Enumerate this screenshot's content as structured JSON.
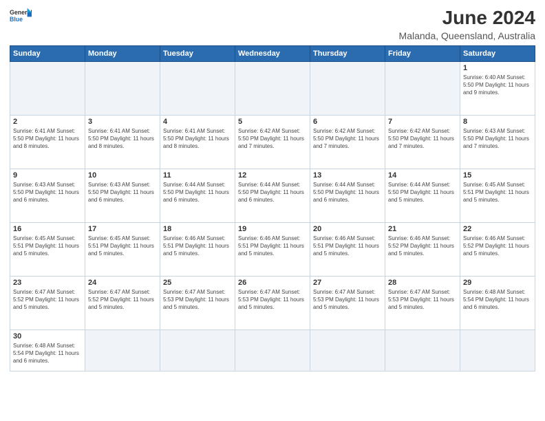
{
  "header": {
    "logo_general": "General",
    "logo_blue": "Blue",
    "month": "June 2024",
    "location": "Malanda, Queensland, Australia"
  },
  "days_of_week": [
    "Sunday",
    "Monday",
    "Tuesday",
    "Wednesday",
    "Thursday",
    "Friday",
    "Saturday"
  ],
  "weeks": [
    [
      {
        "day": "",
        "info": ""
      },
      {
        "day": "",
        "info": ""
      },
      {
        "day": "",
        "info": ""
      },
      {
        "day": "",
        "info": ""
      },
      {
        "day": "",
        "info": ""
      },
      {
        "day": "",
        "info": ""
      },
      {
        "day": "1",
        "info": "Sunrise: 6:40 AM\nSunset: 5:50 PM\nDaylight: 11 hours\nand 9 minutes."
      }
    ],
    [
      {
        "day": "2",
        "info": "Sunrise: 6:41 AM\nSunset: 5:50 PM\nDaylight: 11 hours\nand 8 minutes."
      },
      {
        "day": "3",
        "info": "Sunrise: 6:41 AM\nSunset: 5:50 PM\nDaylight: 11 hours\nand 8 minutes."
      },
      {
        "day": "4",
        "info": "Sunrise: 6:41 AM\nSunset: 5:50 PM\nDaylight: 11 hours\nand 8 minutes."
      },
      {
        "day": "5",
        "info": "Sunrise: 6:42 AM\nSunset: 5:50 PM\nDaylight: 11 hours\nand 7 minutes."
      },
      {
        "day": "6",
        "info": "Sunrise: 6:42 AM\nSunset: 5:50 PM\nDaylight: 11 hours\nand 7 minutes."
      },
      {
        "day": "7",
        "info": "Sunrise: 6:42 AM\nSunset: 5:50 PM\nDaylight: 11 hours\nand 7 minutes."
      },
      {
        "day": "8",
        "info": "Sunrise: 6:43 AM\nSunset: 5:50 PM\nDaylight: 11 hours\nand 7 minutes."
      }
    ],
    [
      {
        "day": "9",
        "info": "Sunrise: 6:43 AM\nSunset: 5:50 PM\nDaylight: 11 hours\nand 6 minutes."
      },
      {
        "day": "10",
        "info": "Sunrise: 6:43 AM\nSunset: 5:50 PM\nDaylight: 11 hours\nand 6 minutes."
      },
      {
        "day": "11",
        "info": "Sunrise: 6:44 AM\nSunset: 5:50 PM\nDaylight: 11 hours\nand 6 minutes."
      },
      {
        "day": "12",
        "info": "Sunrise: 6:44 AM\nSunset: 5:50 PM\nDaylight: 11 hours\nand 6 minutes."
      },
      {
        "day": "13",
        "info": "Sunrise: 6:44 AM\nSunset: 5:50 PM\nDaylight: 11 hours\nand 6 minutes."
      },
      {
        "day": "14",
        "info": "Sunrise: 6:44 AM\nSunset: 5:50 PM\nDaylight: 11 hours\nand 5 minutes."
      },
      {
        "day": "15",
        "info": "Sunrise: 6:45 AM\nSunset: 5:51 PM\nDaylight: 11 hours\nand 5 minutes."
      }
    ],
    [
      {
        "day": "16",
        "info": "Sunrise: 6:45 AM\nSunset: 5:51 PM\nDaylight: 11 hours\nand 5 minutes."
      },
      {
        "day": "17",
        "info": "Sunrise: 6:45 AM\nSunset: 5:51 PM\nDaylight: 11 hours\nand 5 minutes."
      },
      {
        "day": "18",
        "info": "Sunrise: 6:46 AM\nSunset: 5:51 PM\nDaylight: 11 hours\nand 5 minutes."
      },
      {
        "day": "19",
        "info": "Sunrise: 6:46 AM\nSunset: 5:51 PM\nDaylight: 11 hours\nand 5 minutes."
      },
      {
        "day": "20",
        "info": "Sunrise: 6:46 AM\nSunset: 5:51 PM\nDaylight: 11 hours\nand 5 minutes."
      },
      {
        "day": "21",
        "info": "Sunrise: 6:46 AM\nSunset: 5:52 PM\nDaylight: 11 hours\nand 5 minutes."
      },
      {
        "day": "22",
        "info": "Sunrise: 6:46 AM\nSunset: 5:52 PM\nDaylight: 11 hours\nand 5 minutes."
      }
    ],
    [
      {
        "day": "23",
        "info": "Sunrise: 6:47 AM\nSunset: 5:52 PM\nDaylight: 11 hours\nand 5 minutes."
      },
      {
        "day": "24",
        "info": "Sunrise: 6:47 AM\nSunset: 5:52 PM\nDaylight: 11 hours\nand 5 minutes."
      },
      {
        "day": "25",
        "info": "Sunrise: 6:47 AM\nSunset: 5:53 PM\nDaylight: 11 hours\nand 5 minutes."
      },
      {
        "day": "26",
        "info": "Sunrise: 6:47 AM\nSunset: 5:53 PM\nDaylight: 11 hours\nand 5 minutes."
      },
      {
        "day": "27",
        "info": "Sunrise: 6:47 AM\nSunset: 5:53 PM\nDaylight: 11 hours\nand 5 minutes."
      },
      {
        "day": "28",
        "info": "Sunrise: 6:47 AM\nSunset: 5:53 PM\nDaylight: 11 hours\nand 5 minutes."
      },
      {
        "day": "29",
        "info": "Sunrise: 6:48 AM\nSunset: 5:54 PM\nDaylight: 11 hours\nand 6 minutes."
      }
    ],
    [
      {
        "day": "30",
        "info": "Sunrise: 6:48 AM\nSunset: 5:54 PM\nDaylight: 11 hours\nand 6 minutes."
      },
      {
        "day": "",
        "info": ""
      },
      {
        "day": "",
        "info": ""
      },
      {
        "day": "",
        "info": ""
      },
      {
        "day": "",
        "info": ""
      },
      {
        "day": "",
        "info": ""
      },
      {
        "day": "",
        "info": ""
      }
    ]
  ]
}
